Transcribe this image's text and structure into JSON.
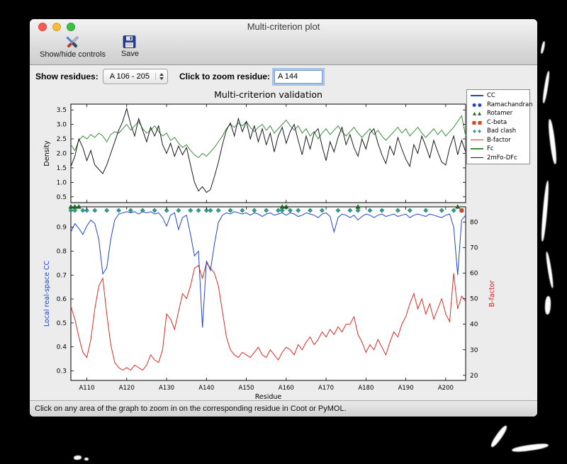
{
  "window": {
    "title": "Multi-criterion plot"
  },
  "toolbar": {
    "show_hide_label": "Show/hide controls",
    "save_label": "Save"
  },
  "controls": {
    "show_residues_label": "Show residues:",
    "range_value": "A 106 - 205",
    "zoom_label": "Click to zoom residue:",
    "zoom_value": "A 144"
  },
  "status_bar": {
    "text": "Click on any area of the graph to zoom in on the corresponding residue in Coot or PyMOL."
  },
  "chart_data": {
    "type": "line",
    "title": "Multi-criterion validation",
    "xlabel": "Residue",
    "x_start": 106,
    "x_end": 205,
    "x_ticks": [
      110,
      120,
      130,
      140,
      150,
      160,
      170,
      180,
      190,
      200
    ],
    "x_tick_labels": [
      "A110",
      "A120",
      "A130",
      "A140",
      "A150",
      "A160",
      "A170",
      "A180",
      "A190",
      "A200"
    ],
    "top_plot": {
      "ylabel": "Density",
      "ylim": [
        0.3,
        3.7
      ],
      "yticks": [
        0.5,
        1.0,
        1.5,
        2.0,
        2.5,
        3.0,
        3.5
      ],
      "series": [
        {
          "name": "Fc",
          "color": "#3e8e3e",
          "values": [
            2.3,
            2.1,
            2.45,
            2.6,
            2.5,
            2.65,
            2.55,
            2.7,
            2.6,
            2.4,
            2.65,
            2.75,
            2.7,
            2.85,
            3.0,
            2.8,
            2.95,
            3.1,
            2.85,
            2.7,
            2.8,
            2.95,
            2.75,
            2.6,
            2.7,
            2.45,
            2.55,
            2.35,
            2.2,
            2.3,
            2.1,
            1.95,
            1.85,
            2.0,
            1.9,
            2.05,
            2.2,
            2.4,
            2.6,
            2.85,
            3.0,
            2.9,
            3.05,
            2.95,
            3.1,
            2.9,
            2.75,
            2.9,
            3.0,
            2.8,
            2.95,
            2.7,
            2.85,
            3.0,
            3.15,
            2.95,
            2.8,
            2.95,
            2.7,
            2.85,
            2.6,
            2.75,
            2.5,
            2.7,
            2.85,
            2.65,
            2.8,
            2.95,
            2.75,
            2.6,
            2.75,
            2.9,
            2.7,
            2.55,
            2.7,
            2.85,
            2.65,
            2.8,
            2.6,
            2.45,
            2.6,
            2.75,
            2.9,
            2.7,
            2.85,
            2.6,
            2.75,
            2.9,
            2.7,
            2.55,
            2.7,
            2.85,
            2.65,
            2.8,
            2.6,
            2.75,
            2.9,
            3.1,
            3.3,
            2.6
          ]
        },
        {
          "name": "2mFo-DFc",
          "color": "#1a1a1a",
          "values": [
            1.55,
            1.9,
            2.5,
            2.2,
            1.75,
            2.1,
            1.6,
            1.45,
            1.3,
            1.6,
            2.0,
            2.4,
            2.8,
            3.1,
            3.55,
            3.0,
            2.6,
            3.2,
            2.8,
            2.4,
            2.9,
            2.6,
            2.95,
            2.3,
            2.0,
            2.35,
            1.9,
            2.25,
            1.95,
            2.2,
            1.6,
            1.0,
            0.7,
            0.85,
            0.65,
            0.75,
            1.2,
            1.7,
            2.3,
            2.8,
            3.05,
            2.6,
            3.2,
            2.75,
            3.1,
            2.5,
            2.95,
            2.4,
            2.85,
            2.3,
            2.7,
            2.05,
            2.6,
            2.9,
            2.35,
            2.75,
            3.0,
            2.45,
            1.95,
            2.6,
            2.15,
            2.7,
            2.85,
            2.25,
            1.75,
            2.4,
            2.05,
            2.55,
            2.9,
            2.3,
            2.65,
            2.2,
            1.9,
            2.5,
            2.15,
            2.7,
            2.85,
            2.35,
            1.95,
            1.65,
            2.25,
            1.95,
            2.55,
            2.15,
            1.8,
            1.55,
            2.3,
            2.0,
            2.6,
            2.25,
            1.85,
            2.45,
            2.05,
            1.7,
            1.6,
            2.2,
            2.6,
            1.95,
            2.45,
            2.05
          ]
        }
      ]
    },
    "bottom_plot": {
      "ylabel_left": "Local real-space CC",
      "ylabel_left_color": "#2244cc",
      "ylim_left": [
        0.26,
        0.985
      ],
      "yticks_left": [
        0.3,
        0.4,
        0.5,
        0.6,
        0.7,
        0.8,
        0.9
      ],
      "ylabel_right": "B-factor",
      "ylabel_right_color": "#cc2222",
      "ylim_right": [
        18,
        86
      ],
      "yticks_right": [
        20,
        30,
        40,
        50,
        60,
        70,
        80
      ],
      "series_left": [
        {
          "name": "CC",
          "color": "#2244cc",
          "values": [
            0.88,
            0.915,
            0.895,
            0.87,
            0.905,
            0.93,
            0.915,
            0.85,
            0.705,
            0.73,
            0.85,
            0.93,
            0.955,
            0.96,
            0.965,
            0.96,
            0.965,
            0.955,
            0.965,
            0.96,
            0.965,
            0.955,
            0.96,
            0.94,
            0.905,
            0.95,
            0.96,
            0.89,
            0.94,
            0.95,
            0.87,
            0.78,
            0.8,
            0.48,
            0.76,
            0.72,
            0.83,
            0.92,
            0.95,
            0.96,
            0.955,
            0.965,
            0.96,
            0.955,
            0.96,
            0.95,
            0.96,
            0.955,
            0.945,
            0.955,
            0.96,
            0.95,
            0.955,
            0.96,
            0.95,
            0.96,
            0.955,
            0.945,
            0.95,
            0.96,
            0.955,
            0.95,
            0.94,
            0.955,
            0.96,
            0.945,
            0.88,
            0.94,
            0.955,
            0.95,
            0.94,
            0.95,
            0.93,
            0.945,
            0.955,
            0.95,
            0.94,
            0.95,
            0.955,
            0.945,
            0.95,
            0.955,
            0.945,
            0.95,
            0.955,
            0.94,
            0.95,
            0.955,
            0.95,
            0.945,
            0.955,
            0.95,
            0.945,
            0.94,
            0.95,
            0.955,
            0.9,
            0.7,
            0.93,
            0.95
          ]
        }
      ],
      "series_right": [
        {
          "name": "B-factor",
          "color": "#dd2a22",
          "values": [
            47,
            42,
            35,
            29,
            27,
            34,
            46,
            55,
            58,
            44,
            32,
            25,
            23,
            22,
            23,
            22,
            24,
            23,
            22,
            24,
            28,
            26,
            25,
            30,
            44,
            42,
            38,
            45,
            52,
            50,
            55,
            62,
            63,
            58,
            64,
            62,
            60,
            55,
            45,
            35,
            30,
            28,
            27,
            29,
            28,
            27,
            29,
            31,
            28,
            27,
            30,
            28,
            26,
            29,
            31,
            30,
            28,
            32,
            30,
            33,
            35,
            32,
            34,
            37,
            35,
            38,
            36,
            39,
            37,
            40,
            40,
            43,
            36,
            33,
            29,
            32,
            30,
            34,
            31,
            28,
            33,
            37,
            35,
            40,
            43,
            48,
            52,
            46,
            50,
            44,
            48,
            42,
            46,
            50,
            44,
            41,
            60,
            46,
            51,
            49
          ]
        }
      ],
      "markers": [
        {
          "name": "Bad clash",
          "shape": "diamond",
          "color": "#2f9e8f",
          "y_left": 0.97,
          "x": [
            106,
            107,
            109,
            110,
            112,
            115,
            118,
            121,
            124,
            127,
            130,
            133,
            136,
            138,
            140,
            141,
            143,
            146,
            149,
            152,
            155,
            158,
            159,
            161,
            163,
            166,
            169,
            173,
            176,
            178,
            181,
            184,
            188,
            191,
            195,
            199,
            202,
            204
          ]
        },
        {
          "name": "Rotamer",
          "shape": "triangle",
          "color": "#1e651e",
          "y_left": 0.985,
          "x": [
            106,
            107,
            108,
            159,
            160,
            178,
            203
          ]
        },
        {
          "name": "C-beta",
          "shape": "square",
          "color": "#cc4422",
          "y_left": 0.97,
          "x": [
            204
          ]
        },
        {
          "name": "Ramachandran",
          "shape": "circle",
          "color": "#2244cc",
          "y_left": 0.97,
          "x": []
        }
      ]
    },
    "legend": [
      {
        "label": "CC",
        "type": "line",
        "color": "#2244cc"
      },
      {
        "label": "Ramachandran",
        "type": "circle",
        "color": "#2244cc"
      },
      {
        "label": "Rotamer",
        "type": "triangle",
        "color": "#1e651e"
      },
      {
        "label": "C-beta",
        "type": "square",
        "color": "#cc4422"
      },
      {
        "label": "Bad clash",
        "type": "diamond",
        "color": "#2f9e8f"
      },
      {
        "label": "B-factor",
        "type": "line",
        "color": "#dd2a22"
      },
      {
        "label": "Fc",
        "type": "line",
        "color": "#3e8e3e"
      },
      {
        "label": "2mFo-DFc",
        "type": "line",
        "color": "#1a1a1a"
      }
    ]
  }
}
